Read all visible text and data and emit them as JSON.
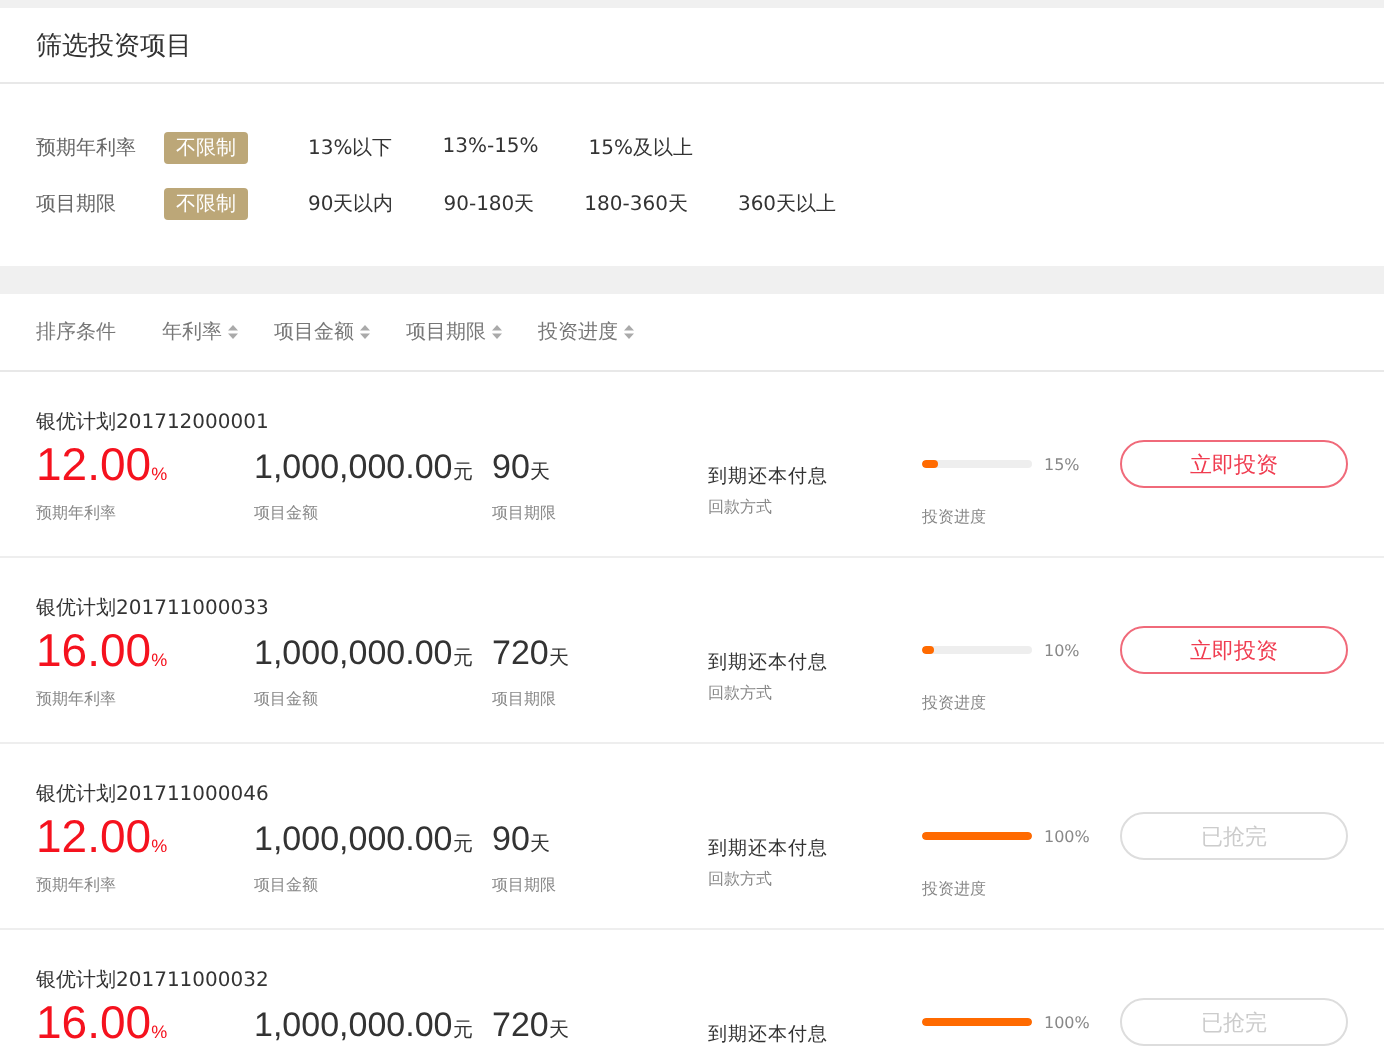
{
  "title": "筛选投资项目",
  "filters": [
    {
      "label": "预期年利率",
      "options": [
        {
          "text": "不限制",
          "selected": true
        },
        {
          "text": "13%以下",
          "selected": false
        },
        {
          "text": "13%-15%",
          "selected": false
        },
        {
          "text": "15%及以上",
          "selected": false
        }
      ]
    },
    {
      "label": "项目期限",
      "options": [
        {
          "text": "不限制",
          "selected": true
        },
        {
          "text": "90天以内",
          "selected": false
        },
        {
          "text": "90-180天",
          "selected": false
        },
        {
          "text": "180-360天",
          "selected": false
        },
        {
          "text": "360天以上",
          "selected": false
        }
      ]
    }
  ],
  "sort": {
    "label": "排序条件",
    "options": [
      "年利率",
      "项目金额",
      "项目期限",
      "投资进度"
    ]
  },
  "products": [
    {
      "name": "银优计划201712000001",
      "rate": "12.00",
      "rate_unit": "%",
      "rate_label": "预期年利率",
      "amount": "1,000,000.00",
      "amount_unit": "元",
      "amount_label": "项目金额",
      "term": "90",
      "term_unit": "天",
      "term_label": "项目期限",
      "method": "到期还本付息",
      "method_label": "回款方式",
      "level": 0.15,
      "percent": "15%",
      "progress_label": "投资进度",
      "button": "立即投资",
      "disabled": false
    },
    {
      "name": "银优计划201711000033",
      "rate": "16.00",
      "rate_unit": "%",
      "rate_label": "预期年利率",
      "amount": "1,000,000.00",
      "amount_unit": "元",
      "amount_label": "项目金额",
      "term": "720",
      "term_unit": "天",
      "term_label": "项目期限",
      "method": "到期还本付息",
      "method_label": "回款方式",
      "level": 0.1,
      "percent": "10%",
      "progress_label": "投资进度",
      "button": "立即投资",
      "disabled": false
    },
    {
      "name": "银优计划201711000046",
      "rate": "12.00",
      "rate_unit": "%",
      "rate_label": "预期年利率",
      "amount": "1,000,000.00",
      "amount_unit": "元",
      "amount_label": "项目金额",
      "term": "90",
      "term_unit": "天",
      "term_label": "项目期限",
      "method": "到期还本付息",
      "method_label": "回款方式",
      "level": 1,
      "percent": "100%",
      "progress_label": "投资进度",
      "button": "已抢完",
      "disabled": true
    },
    {
      "name": "银优计划201711000032",
      "rate": "16.00",
      "rate_unit": "%",
      "amount": "1,000,000.00",
      "amount_unit": "元",
      "term": "720",
      "term_unit": "天",
      "method": "到期还本付息",
      "level": 1,
      "percent": "100%",
      "button": "已抢完",
      "disabled": true
    }
  ]
}
